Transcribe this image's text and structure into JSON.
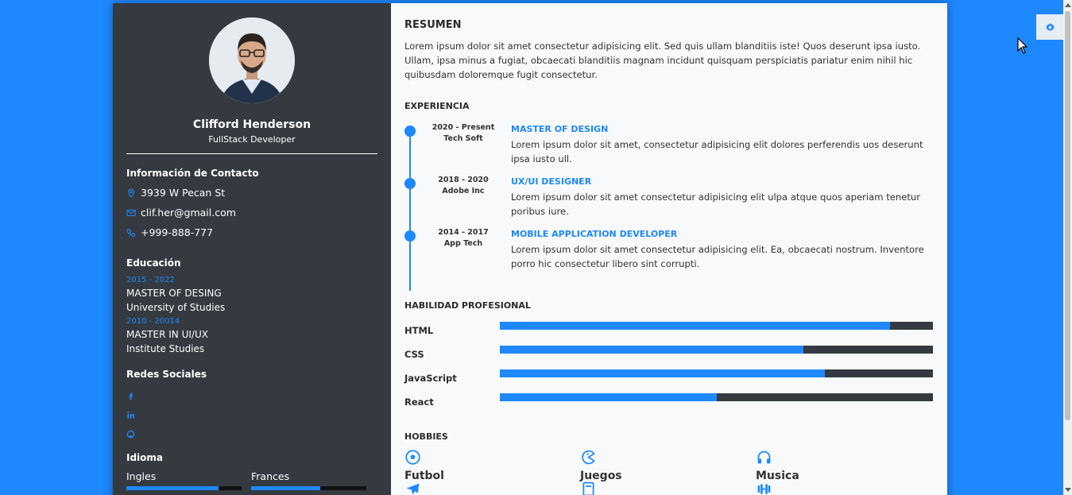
{
  "profile": {
    "name": "Clifford Henderson",
    "role": "FullStack Developer"
  },
  "contact": {
    "title": "Información de Contacto",
    "address": "3939 W Pecan St",
    "email": "clif.her@gmail.com",
    "phone": "+999-888-777",
    "icons": [
      "map-pin-icon",
      "mail-icon",
      "phone-icon"
    ]
  },
  "education": {
    "title": "Educación",
    "items": [
      {
        "date": "2015 - 2022",
        "degree": "MASTER OF DESING",
        "school": "University of Studies"
      },
      {
        "date": "2010 - 20014",
        "degree": "MASTER IN UI/UX",
        "school": "Institute Studies"
      }
    ]
  },
  "social": {
    "title": "Redes Sociales",
    "icons": [
      "facebook-icon",
      "linkedin-icon",
      "github-icon"
    ]
  },
  "languages": {
    "title": "Idioma",
    "items": [
      {
        "name": "Ingles",
        "level": 0.8
      },
      {
        "name": "Frances",
        "level": 0.6
      }
    ]
  },
  "summary": {
    "title": "RESUMEN",
    "text": "Lorem ipsum dolor sit amet consectetur adipisicing elit. Sed quis ullam blanditiis iste! Quos deserunt ipsa iusto. Ullam, ipsa minus a fugiat, obcaecati blanditiis magnam incidunt quisquam perspiciatis pariatur enim nihil hic quibusdam doloremque fugit consectetur."
  },
  "experience": {
    "title": "EXPERIENCIA",
    "items": [
      {
        "period": "2020 - Present",
        "company": "Tech Soft",
        "title": "MASTER OF DESIGN",
        "desc": "Lorem ipsum dolor sit amet, consectetur adipisicing elit dolores perferendis uos deserunt ipsa iusto ull."
      },
      {
        "period": "2018 - 2020",
        "company": "Adobe Inc",
        "title": "UX/UI DESIGNER",
        "desc": "Lorem ipsum dolor sit amet consectetur adipisicing elit ulpa atque quos aperiam tenetur poribus iure."
      },
      {
        "period": "2014 - 2017",
        "company": "App Tech",
        "title": "MOBILE APPLICATION DEVELOPER",
        "desc": "Lorem ipsum dolor sit amet consectetur adipisicing elit. Ea, obcaecati nostrum. Inventore porro hic consectetur libero sint corrupti."
      }
    ]
  },
  "skills": {
    "title": "HABILIDAD PROFESIONAL",
    "items": [
      {
        "name": "HTML",
        "level": 0.9
      },
      {
        "name": "CSS",
        "level": 0.7
      },
      {
        "name": "JavaScript",
        "level": 0.75
      },
      {
        "name": "React",
        "level": 0.5
      }
    ]
  },
  "hobbies": {
    "title": "HOBBIES",
    "items": [
      {
        "label": "Futbol",
        "icon": "soccer-ball-icon"
      },
      {
        "label": "Juegos",
        "icon": "pacman-icon"
      },
      {
        "label": "Musica",
        "icon": "headphones-icon"
      },
      {
        "label": "",
        "icon": "plane-icon"
      },
      {
        "label": "",
        "icon": "book-icon"
      },
      {
        "label": "",
        "icon": "dumbbell-icon"
      }
    ]
  },
  "colors": {
    "accent": "#1e88ff",
    "sidebar": "#343a40",
    "page_bg": "#1e88ff",
    "main_bg": "#f7f9fb"
  },
  "settings": {
    "icon": "gear-icon"
  }
}
